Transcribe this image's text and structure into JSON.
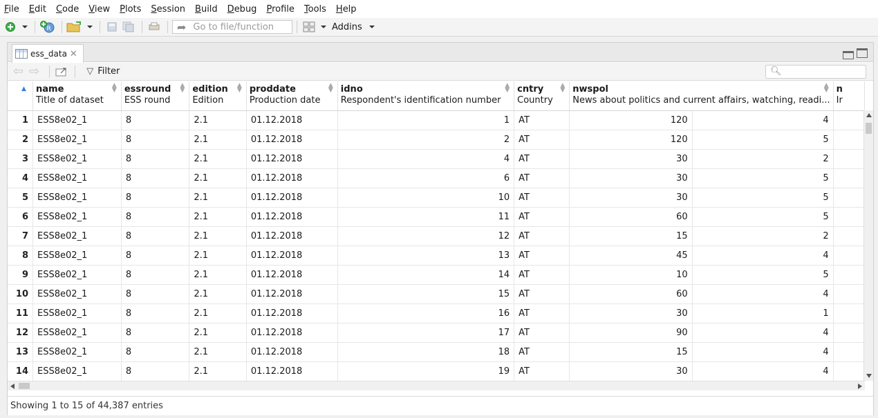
{
  "menu": [
    "File",
    "Edit",
    "Code",
    "View",
    "Plots",
    "Session",
    "Build",
    "Debug",
    "Profile",
    "Tools",
    "Help"
  ],
  "toolbar": {
    "goto_placeholder": "Go to file/function",
    "addins_label": "Addins"
  },
  "tab": {
    "title": "ess_data"
  },
  "viewer": {
    "filter_label": "Filter",
    "search_placeholder": ""
  },
  "columns": [
    {
      "name": "name",
      "label": "Title of dataset"
    },
    {
      "name": "essround",
      "label": "ESS round"
    },
    {
      "name": "edition",
      "label": "Edition"
    },
    {
      "name": "proddate",
      "label": "Production date"
    },
    {
      "name": "idno",
      "label": "Respondent's identification number"
    },
    {
      "name": "cntry",
      "label": "Country"
    },
    {
      "name": "nwspol",
      "label": "News about politics and current affairs, watching, readi..."
    },
    {
      "name": "",
      "label": ""
    },
    {
      "name": "n",
      "label": "Ir"
    }
  ],
  "rows": [
    {
      "n": "1",
      "name": "ESS8e02_1",
      "essround": "8",
      "edition": "2.1",
      "proddate": "01.12.2018",
      "idno": "1",
      "cntry": "AT",
      "nwspol": "120",
      "next": "4"
    },
    {
      "n": "2",
      "name": "ESS8e02_1",
      "essround": "8",
      "edition": "2.1",
      "proddate": "01.12.2018",
      "idno": "2",
      "cntry": "AT",
      "nwspol": "120",
      "next": "5"
    },
    {
      "n": "3",
      "name": "ESS8e02_1",
      "essround": "8",
      "edition": "2.1",
      "proddate": "01.12.2018",
      "idno": "4",
      "cntry": "AT",
      "nwspol": "30",
      "next": "2"
    },
    {
      "n": "4",
      "name": "ESS8e02_1",
      "essround": "8",
      "edition": "2.1",
      "proddate": "01.12.2018",
      "idno": "6",
      "cntry": "AT",
      "nwspol": "30",
      "next": "5"
    },
    {
      "n": "5",
      "name": "ESS8e02_1",
      "essround": "8",
      "edition": "2.1",
      "proddate": "01.12.2018",
      "idno": "10",
      "cntry": "AT",
      "nwspol": "30",
      "next": "5"
    },
    {
      "n": "6",
      "name": "ESS8e02_1",
      "essround": "8",
      "edition": "2.1",
      "proddate": "01.12.2018",
      "idno": "11",
      "cntry": "AT",
      "nwspol": "60",
      "next": "5"
    },
    {
      "n": "7",
      "name": "ESS8e02_1",
      "essround": "8",
      "edition": "2.1",
      "proddate": "01.12.2018",
      "idno": "12",
      "cntry": "AT",
      "nwspol": "15",
      "next": "2"
    },
    {
      "n": "8",
      "name": "ESS8e02_1",
      "essround": "8",
      "edition": "2.1",
      "proddate": "01.12.2018",
      "idno": "13",
      "cntry": "AT",
      "nwspol": "45",
      "next": "4"
    },
    {
      "n": "9",
      "name": "ESS8e02_1",
      "essround": "8",
      "edition": "2.1",
      "proddate": "01.12.2018",
      "idno": "14",
      "cntry": "AT",
      "nwspol": "10",
      "next": "5"
    },
    {
      "n": "10",
      "name": "ESS8e02_1",
      "essround": "8",
      "edition": "2.1",
      "proddate": "01.12.2018",
      "idno": "15",
      "cntry": "AT",
      "nwspol": "60",
      "next": "4"
    },
    {
      "n": "11",
      "name": "ESS8e02_1",
      "essround": "8",
      "edition": "2.1",
      "proddate": "01.12.2018",
      "idno": "16",
      "cntry": "AT",
      "nwspol": "30",
      "next": "1"
    },
    {
      "n": "12",
      "name": "ESS8e02_1",
      "essround": "8",
      "edition": "2.1",
      "proddate": "01.12.2018",
      "idno": "17",
      "cntry": "AT",
      "nwspol": "90",
      "next": "4"
    },
    {
      "n": "13",
      "name": "ESS8e02_1",
      "essround": "8",
      "edition": "2.1",
      "proddate": "01.12.2018",
      "idno": "18",
      "cntry": "AT",
      "nwspol": "15",
      "next": "4"
    },
    {
      "n": "14",
      "name": "ESS8e02_1",
      "essround": "8",
      "edition": "2.1",
      "proddate": "01.12.2018",
      "idno": "19",
      "cntry": "AT",
      "nwspol": "30",
      "next": "4"
    }
  ],
  "status": "Showing 1 to 15 of 44,387 entries"
}
